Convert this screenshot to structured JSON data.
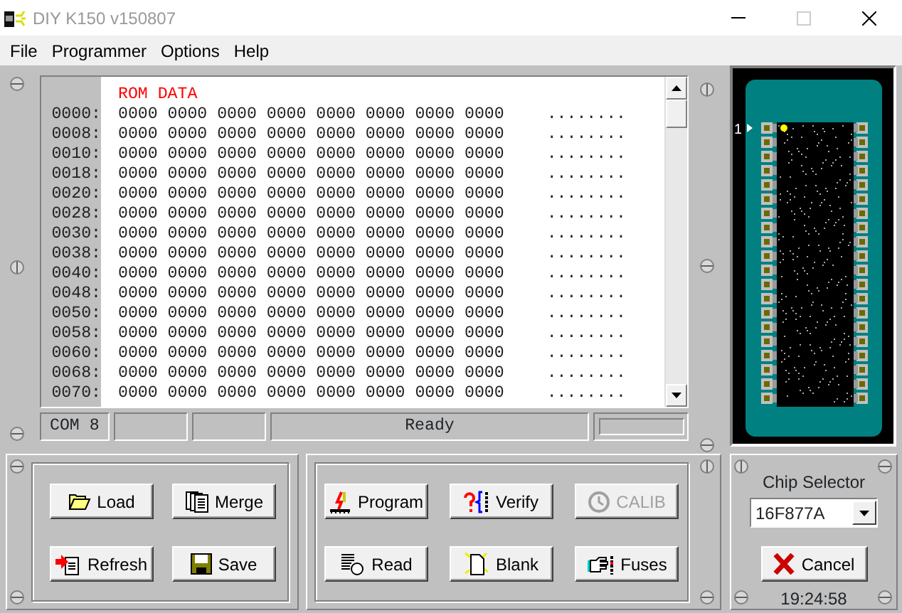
{
  "window": {
    "title": "DIY K150 v150807"
  },
  "menu": [
    "File",
    "Programmer",
    "Options",
    "Help"
  ],
  "hex_view": {
    "heading": "ROM DATA",
    "rows": [
      {
        "address": "0000:",
        "data": "0000 0000 0000 0000 0000 0000 0000 0000",
        "ascii": "........"
      },
      {
        "address": "0008:",
        "data": "0000 0000 0000 0000 0000 0000 0000 0000",
        "ascii": "........"
      },
      {
        "address": "0010:",
        "data": "0000 0000 0000 0000 0000 0000 0000 0000",
        "ascii": "........"
      },
      {
        "address": "0018:",
        "data": "0000 0000 0000 0000 0000 0000 0000 0000",
        "ascii": "........"
      },
      {
        "address": "0020:",
        "data": "0000 0000 0000 0000 0000 0000 0000 0000",
        "ascii": "........"
      },
      {
        "address": "0028:",
        "data": "0000 0000 0000 0000 0000 0000 0000 0000",
        "ascii": "........"
      },
      {
        "address": "0030:",
        "data": "0000 0000 0000 0000 0000 0000 0000 0000",
        "ascii": "........"
      },
      {
        "address": "0038:",
        "data": "0000 0000 0000 0000 0000 0000 0000 0000",
        "ascii": "........"
      },
      {
        "address": "0040:",
        "data": "0000 0000 0000 0000 0000 0000 0000 0000",
        "ascii": "........"
      },
      {
        "address": "0048:",
        "data": "0000 0000 0000 0000 0000 0000 0000 0000",
        "ascii": "........"
      },
      {
        "address": "0050:",
        "data": "0000 0000 0000 0000 0000 0000 0000 0000",
        "ascii": "........"
      },
      {
        "address": "0058:",
        "data": "0000 0000 0000 0000 0000 0000 0000 0000",
        "ascii": "........"
      },
      {
        "address": "0060:",
        "data": "0000 0000 0000 0000 0000 0000 0000 0000",
        "ascii": "........"
      },
      {
        "address": "0068:",
        "data": "0000 0000 0000 0000 0000 0000 0000 0000",
        "ascii": "........"
      },
      {
        "address": "0070:",
        "data": "0000 0000 0000 0000 0000 0000 0000 0000",
        "ascii": "........"
      }
    ]
  },
  "status_bar": {
    "port": "COM 8",
    "message": "Ready",
    "progress": {
      "level": 0
    }
  },
  "chip_view": {
    "pin1_label": "1"
  },
  "file_buttons": [
    {
      "label": "Load",
      "disabled": false
    },
    {
      "label": "Merge",
      "disabled": false
    },
    {
      "label": "Refresh",
      "disabled": false
    },
    {
      "label": "Save",
      "disabled": false
    }
  ],
  "device_buttons": [
    {
      "label": "Program",
      "disabled": false
    },
    {
      "label": "Verify",
      "disabled": false
    },
    {
      "label": "CALIB",
      "disabled": true
    },
    {
      "label": "Read",
      "disabled": false
    },
    {
      "label": "Blank",
      "disabled": false
    },
    {
      "label": "Fuses",
      "disabled": false
    }
  ],
  "chip_selector": {
    "label": "Chip Selector",
    "value": "16F877A"
  },
  "cancel_button": {
    "label": "Cancel"
  },
  "clock": "19:24:58"
}
